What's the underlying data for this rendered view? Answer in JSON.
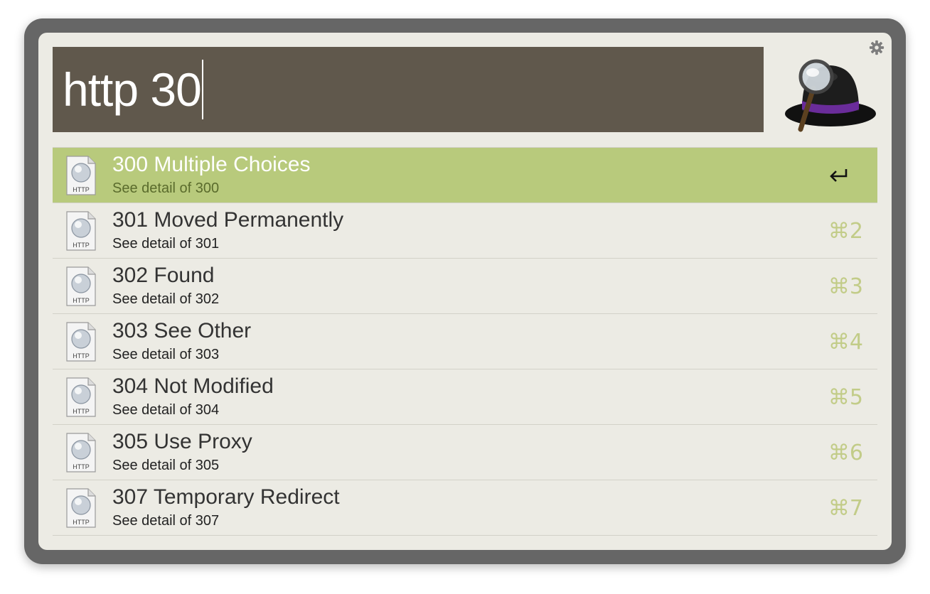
{
  "search": {
    "query": "http 30"
  },
  "icons": {
    "settings": "gear-icon",
    "logo": "alfred-hat-logo",
    "result": "http-file-icon",
    "return": "return-arrow-icon"
  },
  "colors": {
    "frame": "#666666",
    "panel": "#ecebe4",
    "search_bg": "#60584c",
    "selected_row": "#b8ca7c",
    "shortcut": "#c2cc88"
  },
  "results": [
    {
      "title": "300 Multiple Choices",
      "subtitle": "See detail of 300",
      "shortcut": "",
      "selected": true,
      "icon_label": "HTTP"
    },
    {
      "title": "301 Moved Permanently",
      "subtitle": "See detail of 301",
      "shortcut": "⌘2",
      "selected": false,
      "icon_label": "HTTP"
    },
    {
      "title": "302 Found",
      "subtitle": "See detail of 302",
      "shortcut": "⌘3",
      "selected": false,
      "icon_label": "HTTP"
    },
    {
      "title": "303 See Other",
      "subtitle": "See detail of 303",
      "shortcut": "⌘4",
      "selected": false,
      "icon_label": "HTTP"
    },
    {
      "title": "304 Not Modified",
      "subtitle": "See detail of 304",
      "shortcut": "⌘5",
      "selected": false,
      "icon_label": "HTTP"
    },
    {
      "title": "305 Use Proxy",
      "subtitle": "See detail of 305",
      "shortcut": "⌘6",
      "selected": false,
      "icon_label": "HTTP"
    },
    {
      "title": "307 Temporary Redirect",
      "subtitle": "See detail of 307",
      "shortcut": "⌘7",
      "selected": false,
      "icon_label": "HTTP"
    }
  ]
}
